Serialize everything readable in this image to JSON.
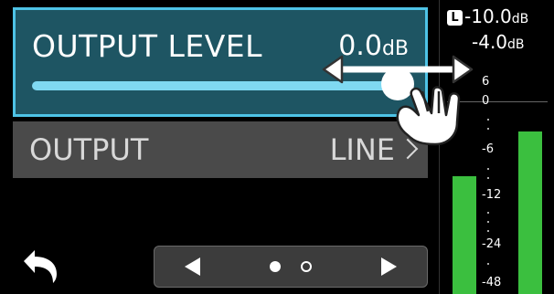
{
  "output_level": {
    "label": "OUTPUT LEVEL",
    "value_number": "0.0",
    "value_unit": "dB",
    "slider_fraction": 1.0
  },
  "output": {
    "label": "OUTPUT",
    "value": "LINE"
  },
  "meters": {
    "left_peak_number": "-10.0",
    "left_peak_unit": "dB",
    "left_badge": "L",
    "right_peak_number": "-4.0",
    "right_peak_unit": "dB",
    "scale": [
      "6",
      "0",
      "-6",
      "-12",
      "-24",
      "-48"
    ],
    "left_level_db": -10.0,
    "right_level_db": -4.0
  },
  "pager": {
    "page_count": 2,
    "current_page": 1
  },
  "colors": {
    "accent": "#4ec3e6",
    "panel_selected": "#1e5563",
    "meter_green": "#3bbf3f"
  },
  "icons": [
    "back-arrow-icon",
    "triangle-left-icon",
    "triangle-right-icon",
    "chevron-right-icon",
    "hand-swipe-icon"
  ]
}
